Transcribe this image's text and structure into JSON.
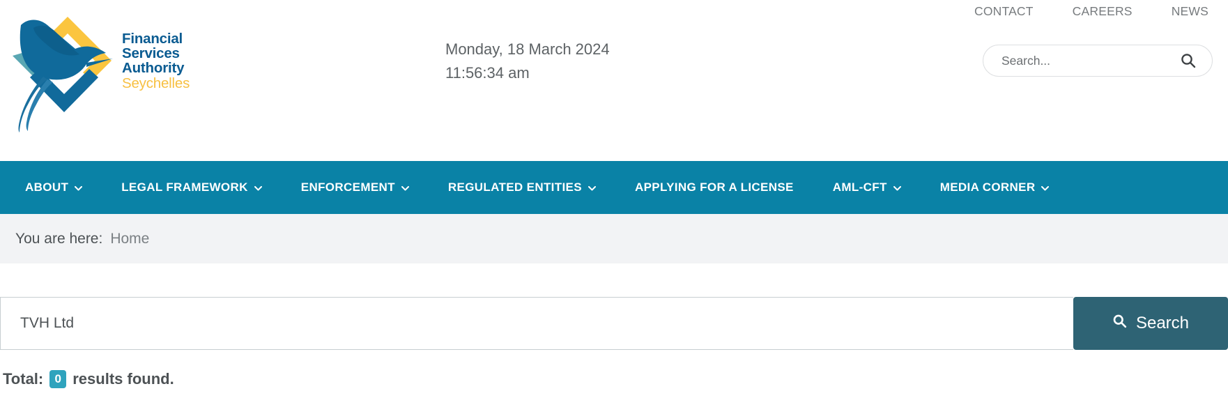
{
  "topnav": {
    "items": [
      {
        "label": "CONTACT",
        "name": "top-nav-contact"
      },
      {
        "label": "CAREERS",
        "name": "top-nav-careers"
      },
      {
        "label": "NEWS",
        "name": "top-nav-news"
      }
    ]
  },
  "logo": {
    "line1": "Financial",
    "line2": "Services",
    "line3": "Authority",
    "line4": "Seychelles",
    "icon": "tropicbird-diamond-logo",
    "text_color": "#0a5b91",
    "accent_color": "#f7c043"
  },
  "header": {
    "date": "Monday, 18 March 2024",
    "time": "11:56:34 am",
    "search": {
      "placeholder": "Search...",
      "value": "",
      "icon": "search-icon"
    }
  },
  "mainnav": {
    "background": "#0a82a6",
    "items": [
      {
        "label": "ABOUT",
        "caret": true,
        "name": "nav-item-about"
      },
      {
        "label": "LEGAL FRAMEWORK",
        "caret": true,
        "name": "nav-item-legal-framework"
      },
      {
        "label": "ENFORCEMENT",
        "caret": true,
        "name": "nav-item-enforcement"
      },
      {
        "label": "REGULATED ENTITIES",
        "caret": true,
        "name": "nav-item-regulated-entities"
      },
      {
        "label": "APPLYING FOR A LICENSE",
        "caret": false,
        "name": "nav-item-applying-for-a-license"
      },
      {
        "label": "AML-CFT",
        "caret": true,
        "name": "nav-item-aml-cft"
      },
      {
        "label": "MEDIA CORNER",
        "caret": true,
        "name": "nav-item-media-corner"
      }
    ]
  },
  "breadcrumb": {
    "label": "You are here:",
    "current": "Home"
  },
  "main": {
    "search": {
      "value": "TVH Ltd",
      "placeholder": "",
      "button_label": "Search",
      "button_icon": "search-icon",
      "button_color": "#2e6374"
    },
    "results": {
      "prefix": "Total:",
      "count": "0",
      "suffix": "results found.",
      "badge_color": "#2fa3bd"
    }
  }
}
